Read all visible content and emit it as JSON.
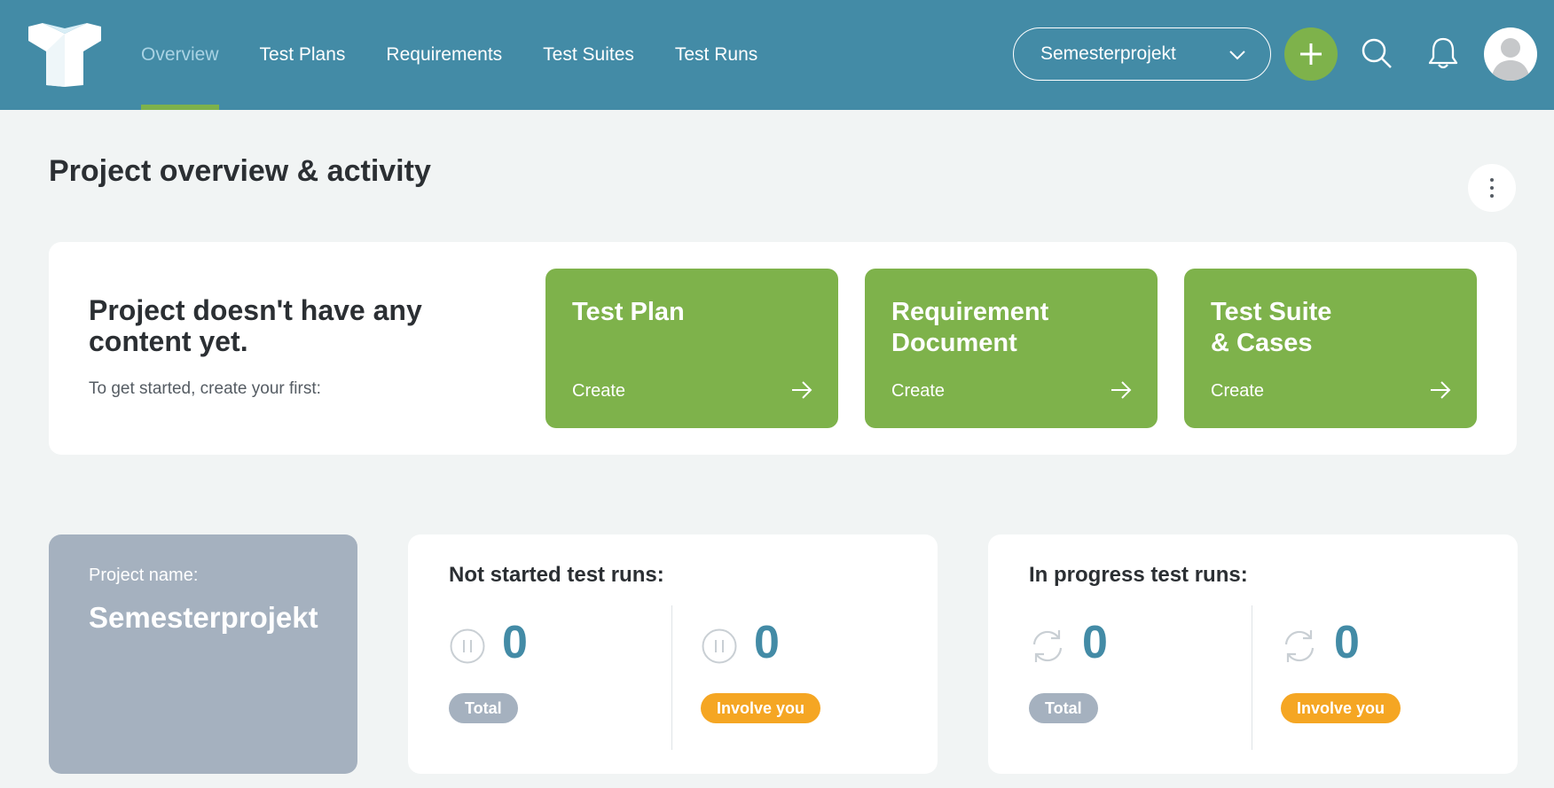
{
  "nav": {
    "items": [
      {
        "label": "Overview",
        "active": true
      },
      {
        "label": "Test Plans",
        "active": false
      },
      {
        "label": "Requirements",
        "active": false
      },
      {
        "label": "Test Suites",
        "active": false
      },
      {
        "label": "Test Runs",
        "active": false
      }
    ],
    "project_select": "Semesterprojekt"
  },
  "colors": {
    "header": "#438ba6",
    "accent_green": "#7eb24b",
    "badge_total": "#a5b1bf",
    "badge_involve": "#f5a623",
    "stat_number": "#438ba6"
  },
  "page": {
    "title": "Project overview & activity"
  },
  "empty_state": {
    "title": "Project doesn't have any content yet.",
    "subtitle": "To get started, create your first:",
    "cards": [
      {
        "title": "Test Plan",
        "action": "Create"
      },
      {
        "title": "Requirement Document",
        "action": "Create"
      },
      {
        "title": "Test Suite & Cases",
        "action": "Create"
      }
    ]
  },
  "project_card": {
    "label": "Project name:",
    "name": "Semesterprojekt"
  },
  "not_started": {
    "title": "Not started test runs:",
    "total": {
      "value": "0",
      "label": "Total",
      "icon": "pause-icon"
    },
    "involve": {
      "value": "0",
      "label": "Involve you",
      "icon": "pause-icon"
    }
  },
  "in_progress": {
    "title": "In progress test runs:",
    "total": {
      "value": "0",
      "label": "Total",
      "icon": "refresh-icon"
    },
    "involve": {
      "value": "0",
      "label": "Involve you",
      "icon": "refresh-icon"
    }
  }
}
